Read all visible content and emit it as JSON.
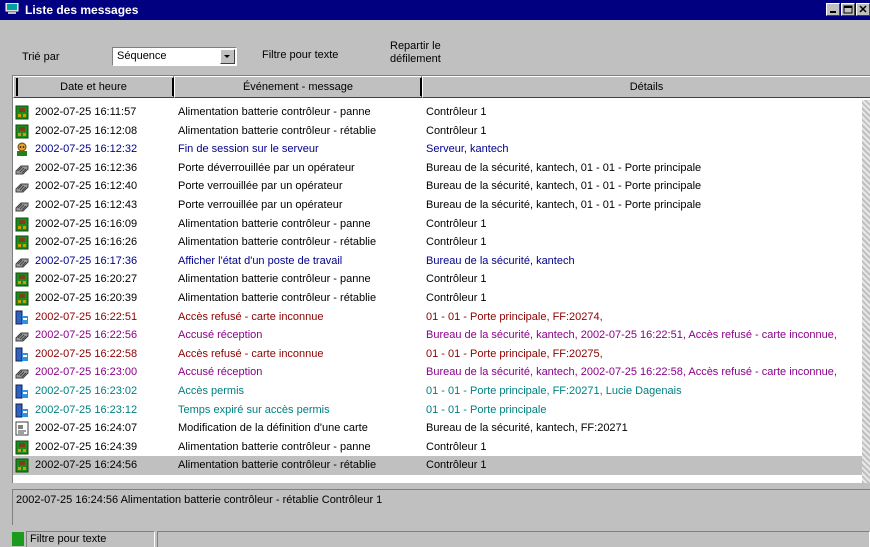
{
  "window": {
    "title": "Liste des messages",
    "buttons": {
      "minimize": "_",
      "restore": "□",
      "close": "×"
    }
  },
  "toolbar": {
    "sort_label": "Trié par",
    "sort_value": "Séquence",
    "filter_label": "Filtre pour texte",
    "scroll_label_line1": "Repartir le",
    "scroll_label_line2": "défilement"
  },
  "table": {
    "columns": [
      "Date et heure",
      "Événement - message",
      "Détails"
    ],
    "rows": [
      {
        "icon": "controller-board-icon",
        "date": "2002-07-25 16:11:57",
        "event": "Alimentation batterie contrôleur - panne",
        "details": "Contrôleur 1",
        "color": "#000000"
      },
      {
        "icon": "controller-board-icon",
        "date": "2002-07-25 16:12:08",
        "event": "Alimentation batterie contrôleur - rétablie",
        "details": "Contrôleur 1",
        "color": "#000000"
      },
      {
        "icon": "operator-icon",
        "date": "2002-07-25 16:12:32",
        "event": "Fin de session sur le serveur",
        "details": "Serveur, kantech",
        "color": "#00008b"
      },
      {
        "icon": "workstation-icon",
        "date": "2002-07-25 16:12:36",
        "event": "Porte déverrouillée par un opérateur",
        "details": "Bureau de la sécurité, kantech, 01 - 01 - Porte principale",
        "color": "#000000"
      },
      {
        "icon": "workstation-icon",
        "date": "2002-07-25 16:12:40",
        "event": "Porte verrouillée par un opérateur",
        "details": "Bureau de la sécurité, kantech, 01 - 01 - Porte principale",
        "color": "#000000"
      },
      {
        "icon": "workstation-icon",
        "date": "2002-07-25 16:12:43",
        "event": "Porte verrouillée par un opérateur",
        "details": "Bureau de la sécurité, kantech, 01 - 01 - Porte principale",
        "color": "#000000"
      },
      {
        "icon": "controller-board-icon",
        "date": "2002-07-25 16:16:09",
        "event": "Alimentation batterie contrôleur - panne",
        "details": "Contrôleur 1",
        "color": "#000000"
      },
      {
        "icon": "controller-board-icon",
        "date": "2002-07-25 16:16:26",
        "event": "Alimentation batterie contrôleur - rétablie",
        "details": "Contrôleur 1",
        "color": "#000000"
      },
      {
        "icon": "workstation-icon",
        "date": "2002-07-25 16:17:36",
        "event": "Afficher l'état d'un poste de travail",
        "details": "Bureau de la sécurité, kantech",
        "color": "#00008b"
      },
      {
        "icon": "controller-board-icon",
        "date": "2002-07-25 16:20:27",
        "event": "Alimentation batterie contrôleur - panne",
        "details": "Contrôleur 1",
        "color": "#000000"
      },
      {
        "icon": "controller-board-icon",
        "date": "2002-07-25 16:20:39",
        "event": "Alimentation batterie contrôleur - rétablie",
        "details": "Contrôleur 1",
        "color": "#000000"
      },
      {
        "icon": "door-access-icon",
        "date": "2002-07-25 16:22:51",
        "event": "Accès refusé - carte inconnue",
        "details": "01 - 01 - Porte principale, FF:20274,",
        "color": "#8b0000"
      },
      {
        "icon": "workstation-icon",
        "date": "2002-07-25 16:22:56",
        "event": "Accusé réception",
        "details": "Bureau de la sécurité, kantech, 2002-07-25 16:22:51, Accès refusé - carte inconnue,",
        "color": "#8b008b"
      },
      {
        "icon": "door-access-icon",
        "date": "2002-07-25 16:22:58",
        "event": "Accès refusé - carte inconnue",
        "details": "01 - 01 - Porte principale, FF:20275,",
        "color": "#8b0000"
      },
      {
        "icon": "workstation-icon",
        "date": "2002-07-25 16:23:00",
        "event": "Accusé réception",
        "details": "Bureau de la sécurité, kantech, 2002-07-25 16:22:58, Accès refusé - carte inconnue,",
        "color": "#8b008b"
      },
      {
        "icon": "door-access-icon",
        "date": "2002-07-25 16:23:02",
        "event": "Accès permis",
        "details": "01 - 01 - Porte principale, FF:20271, Lucie Dagenais",
        "color": "#008080"
      },
      {
        "icon": "door-access-icon",
        "date": "2002-07-25 16:23:12",
        "event": "Temps expiré sur accès permis",
        "details": "01 - 01 - Porte principale",
        "color": "#008080"
      },
      {
        "icon": "card-edit-icon",
        "date": "2002-07-25 16:24:07",
        "event": "Modification de la définition d'une carte",
        "details": "Bureau de la sécurité, kantech, FF:20271",
        "color": "#000000"
      },
      {
        "icon": "controller-board-icon",
        "date": "2002-07-25 16:24:39",
        "event": "Alimentation batterie contrôleur - panne",
        "details": "Contrôleur 1",
        "color": "#000000"
      },
      {
        "icon": "controller-board-icon",
        "date": "2002-07-25 16:24:56",
        "event": "Alimentation batterie contrôleur - rétablie",
        "details": "Contrôleur 1",
        "color": "#000000",
        "selected": true
      }
    ]
  },
  "detail_text": "2002-07-25 16:24:56  Alimentation batterie contrôleur - rétablie  Contrôleur 1",
  "status": {
    "panel1": "Filtre pour texte"
  },
  "colors": {
    "titlebar": "#000080",
    "status_indicator": "#1b9b1b"
  }
}
